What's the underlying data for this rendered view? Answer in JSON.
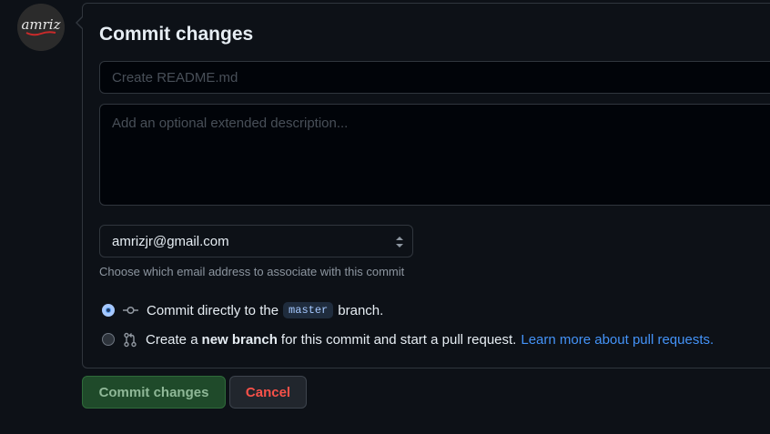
{
  "avatar": {
    "text": "amriz"
  },
  "form": {
    "title": "Commit changes",
    "summary_placeholder": "Create README.md",
    "summary_value": "",
    "description_placeholder": "Add an optional extended description...",
    "description_value": ""
  },
  "email": {
    "selected": "amrizjr@gmail.com",
    "help": "Choose which email address to associate with this commit"
  },
  "options": {
    "direct": {
      "text_before": "Commit directly to the",
      "branch": "master",
      "text_after": "branch.",
      "selected": true
    },
    "new_branch": {
      "text_before": "Create a",
      "bold": "new branch",
      "text_after": "for this commit and start a pull request.",
      "link": "Learn more about pull requests.",
      "selected": false
    }
  },
  "buttons": {
    "commit": "Commit changes",
    "cancel": "Cancel"
  },
  "colors": {
    "background": "#0d1117",
    "border": "#30363d",
    "link": "#4493f8",
    "cancel_text": "#f85149",
    "commit_bg": "#1f4a2a"
  },
  "icons": {
    "direct": "git-commit-icon",
    "new_branch": "git-pull-request-icon",
    "select": "select-arrows-icon"
  }
}
